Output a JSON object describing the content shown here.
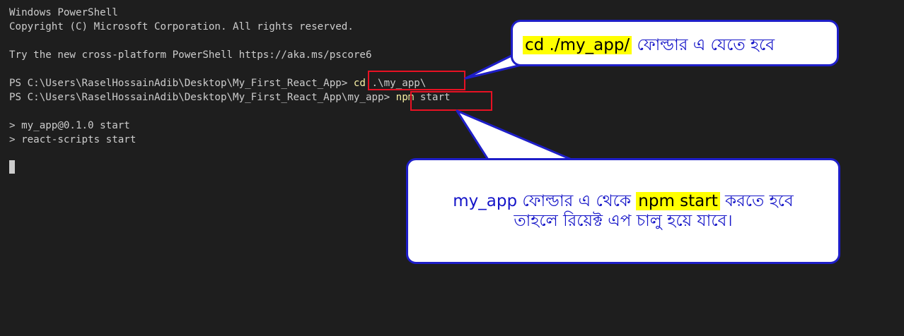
{
  "terminal": {
    "lines": [
      "Windows PowerShell",
      "Copyright (C) Microsoft Corporation. All rights reserved.",
      "",
      "Try the new cross-platform PowerShell https://aka.ms/pscore6",
      ""
    ],
    "prompt1": "PS C:\\Users\\RaselHossainAdib\\Desktop\\My_First_React_App> ",
    "cmd1_keyword": "cd",
    "cmd1_args": " .\\my_app\\",
    "prompt2": "PS C:\\Users\\RaselHossainAdib\\Desktop\\My_First_React_App\\my_app> ",
    "cmd2_keyword": "npm",
    "cmd2_args": " start",
    "output": [
      "> my_app@0.1.0 start",
      "> react-scripts start"
    ]
  },
  "callouts": {
    "top": {
      "highlight": "cd ./my_app/",
      "text": " ফোল্ডার এ যেতে হবে"
    },
    "bottom": {
      "prefix": "my_app ফোল্ডার এ থেকে ",
      "highlight": "npm start",
      "suffix": " করতে হবে",
      "line2": "তাহলে রিয়েক্ট এপ চালু হয়ে যাবে।"
    }
  },
  "colors": {
    "background": "#1e1e1e",
    "terminal_text": "#cccccc",
    "command_keyword": "#f9f1a5",
    "highlight_box": "#e81123",
    "callout_border": "#1e1ec8",
    "callout_text": "#1414c8",
    "callout_highlight": "#ffff00"
  }
}
